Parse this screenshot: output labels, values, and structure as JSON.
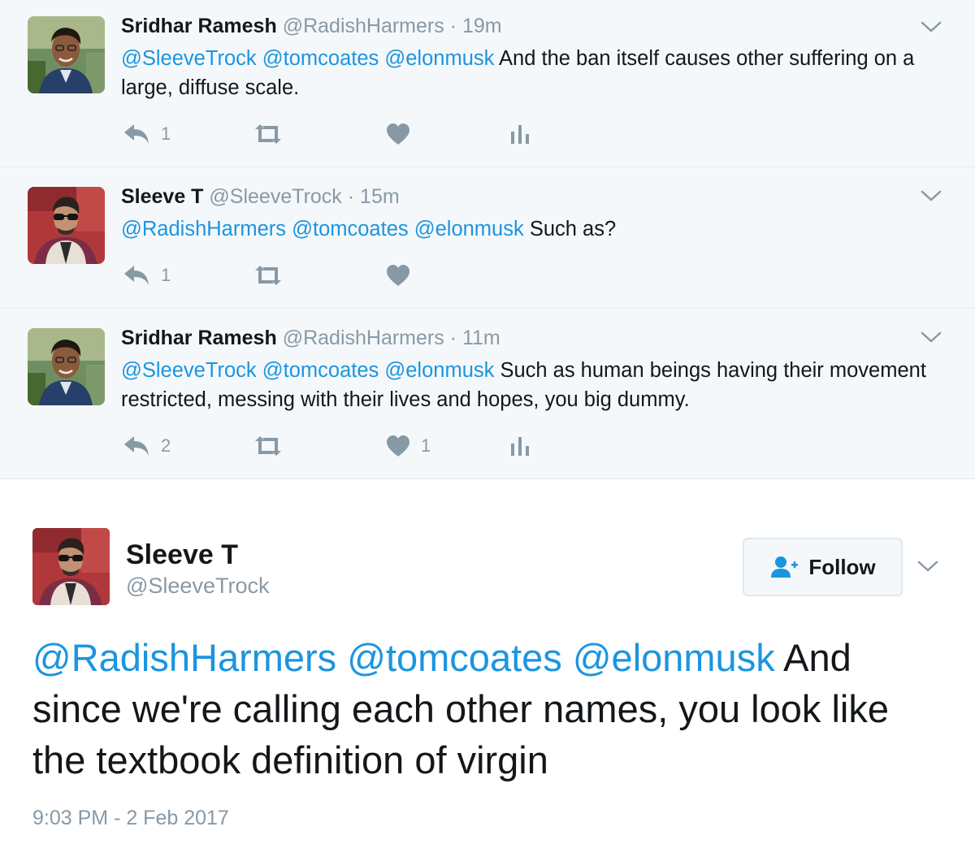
{
  "colors": {
    "accent": "#1b95e0",
    "muted": "#8899a6",
    "reply_bg": "#f5f8fa",
    "border": "#e1e8ed"
  },
  "replies": [
    {
      "name": "Sridhar Ramesh",
      "handle": "@RadishHarmers",
      "separator": "·",
      "time": "19m",
      "mentions": "@SleeveTrock @tomcoates @elonmusk",
      "text": " And the ban itself causes other suffering on a large, diffuse scale.",
      "reply_count": "1",
      "like_count": "",
      "icons": [
        "reply-icon",
        "retweet-icon",
        "like-icon",
        "analytics-icon"
      ]
    },
    {
      "name": "Sleeve T",
      "handle": "@SleeveTrock",
      "separator": "·",
      "time": "15m",
      "mentions": "@RadishHarmers @tomcoates @elonmusk",
      "text": " Such as?",
      "reply_count": "1",
      "like_count": "",
      "icons": [
        "reply-icon",
        "retweet-icon",
        "like-icon"
      ]
    },
    {
      "name": "Sridhar Ramesh",
      "handle": "@RadishHarmers",
      "separator": "·",
      "time": "11m",
      "mentions": "@SleeveTrock @tomcoates @elonmusk",
      "text": " Such as human beings having their movement restricted, messing with their lives and hopes, you big dummy.",
      "reply_count": "2",
      "like_count": "1",
      "icons": [
        "reply-icon",
        "retweet-icon",
        "like-icon",
        "analytics-icon"
      ]
    }
  ],
  "main_tweet": {
    "name": "Sleeve T",
    "handle": "@SleeveTrock",
    "follow_label": "Follow",
    "mentions": "@RadishHarmers @tomcoates @elonmusk",
    "text": " And since we're calling each other names, you look like the textbook definition of virgin",
    "timestamp": "9:03 PM - 2 Feb 2017"
  }
}
